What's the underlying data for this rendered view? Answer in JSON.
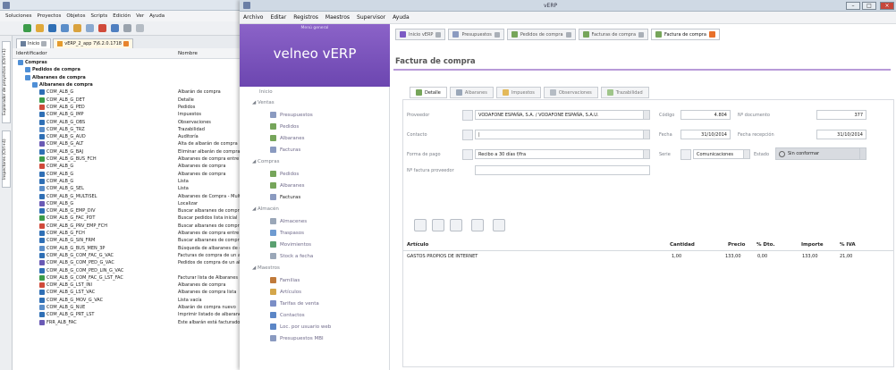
{
  "back_window": {
    "menu": [
      "Soluciones",
      "Proyectos",
      "Objetos",
      "Scripts",
      "Edición",
      "Ver",
      "Ayuda"
    ],
    "tabs": [
      {
        "label": "Inicio"
      },
      {
        "label": "vERP_2_app 7\\6.2.0.1718"
      }
    ],
    "side_tabs": [
      "Explorador de proyectos (Ctrl+1)",
      "Inspectores (Ctrl+4)"
    ],
    "columns": {
      "id": "Identificador",
      "name": "Nombre"
    },
    "tree": [
      {
        "id": "Compras",
        "desc": "",
        "level": 0,
        "bold": true
      },
      {
        "id": "Pedidos de compra",
        "desc": "",
        "level": 1,
        "bold": true
      },
      {
        "id": "Albaranes de compra",
        "desc": "",
        "level": 1,
        "bold": true
      },
      {
        "id": "Albaranes de compra",
        "desc": "",
        "level": 2,
        "bold": true
      },
      {
        "id": "COM_ALB_G",
        "desc": "Albarán de compra",
        "level": 3
      },
      {
        "id": "COM_ALB_G_DET",
        "desc": "Detalle",
        "level": 3
      },
      {
        "id": "COM_ALB_G_PED",
        "desc": "Pedidos",
        "level": 3
      },
      {
        "id": "COM_ALB_G_IMP",
        "desc": "Impuestos",
        "level": 3
      },
      {
        "id": "COM_ALB_G_OBS",
        "desc": "Observaciones",
        "level": 3
      },
      {
        "id": "COM_ALB_G_TRZ",
        "desc": "Trazabilidad",
        "level": 3
      },
      {
        "id": "COM_ALB_G_AUD",
        "desc": "Auditoría",
        "level": 3
      },
      {
        "id": "COM_ALB_G_ALT",
        "desc": "Alta de albarán de compra",
        "level": 3
      },
      {
        "id": "COM_ALB_G_BAJ",
        "desc": "Eliminar albarán de compra",
        "level": 3
      },
      {
        "id": "COM_ALB_G_BUS_FCH",
        "desc": "Albaranes de compra entre fechas",
        "level": 3
      },
      {
        "id": "COM_ALB_G",
        "desc": "Albaranes de compra",
        "level": 3
      },
      {
        "id": "COM_ALB_G",
        "desc": "Albaranes de compra",
        "level": 3
      },
      {
        "id": "COM_ALB_G",
        "desc": "Lista",
        "level": 3
      },
      {
        "id": "COM_ALB_G_SEL",
        "desc": "Lista",
        "level": 3
      },
      {
        "id": "COM_ALB_G_MULTISEL",
        "desc": "Albaranes de Compra - Multiselección",
        "level": 3
      },
      {
        "id": "COM_ALB_G",
        "desc": "Localizar",
        "level": 3
      },
      {
        "id": "COM_ALB_G_EMP_DIV",
        "desc": "Buscar albaranes de compra",
        "level": 3
      },
      {
        "id": "COM_ALB_G_FAC_PDT",
        "desc": "Buscar pedidos lista inicial",
        "level": 3
      },
      {
        "id": "COM_ALB_G_PRV_EMP_FCH",
        "desc": "Buscar albaranes de compra",
        "level": 3
      },
      {
        "id": "COM_ALB_G_FCH",
        "desc": "Albaranes de compra entre fechas",
        "level": 3
      },
      {
        "id": "COM_ALB_G_SIN_FRM",
        "desc": "Buscar albaranes de compra",
        "level": 3
      },
      {
        "id": "COM_ALB_G_BUS_MEN_3P",
        "desc": "Búsqueda de albaranes de compra",
        "level": 3
      },
      {
        "id": "COM_ALB_G_COM_FAC_G_VAC",
        "desc": "Facturas de compra de un albarán",
        "level": 3
      },
      {
        "id": "COM_ALB_G_COM_PED_G_VAC",
        "desc": "Pedidos de compra de un albarán",
        "level": 3
      },
      {
        "id": "COM_ALB_G_COM_PED_LIN_G_VAC",
        "desc": "",
        "level": 3
      },
      {
        "id": "COM_ALB_G_COM_FAC_G_LST_FAC",
        "desc": "Facturar lista de Albaranes",
        "level": 3
      },
      {
        "id": "COM_ALB_G_LST_INI",
        "desc": "Albaranes de compra",
        "level": 3
      },
      {
        "id": "COM_ALB_G_LST_VAC",
        "desc": "Albaranes de compra lista",
        "level": 3
      },
      {
        "id": "COM_ALB_G_MOV_G_VAC",
        "desc": "Lista vacía",
        "level": 3
      },
      {
        "id": "COM_ALB_G_NUE",
        "desc": "Albarán de compra nuevo",
        "level": 3
      },
      {
        "id": "COM_ALB_G_PRT_LST",
        "desc": "Imprimir listado de albaranes",
        "level": 3
      },
      {
        "id": "FRR_ALB_FAC",
        "desc": "Este albarán está facturado",
        "level": 3
      }
    ]
  },
  "front_window": {
    "title": "vERP",
    "menu": [
      "Archivo",
      "Editar",
      "Registros",
      "Maestros",
      "Supervisor",
      "Ayuda"
    ],
    "brand_sub": "Menú general",
    "brand": "velneo vERP",
    "nav": {
      "inicio": "Inicio",
      "ventas": "Ventas",
      "ventas_items": [
        "Presupuestos",
        "Pedidos",
        "Albaranes",
        "Facturas"
      ],
      "compras": "Compras",
      "compras_items": [
        "Pedidos",
        "Albaranes",
        "Facturas"
      ],
      "almacen": "Almacén",
      "almacen_items": [
        "Almacenes",
        "Traspasos",
        "Movimientos",
        "Stock a fecha"
      ],
      "maestros": "Maestros",
      "maestros_items": [
        "Familias",
        "Artículos",
        "Tarifas de venta",
        "Contactos",
        "Loc. por usuario web",
        "Presupuestos MBI"
      ]
    },
    "tabs": [
      "Inicio vERP",
      "Presupuestos",
      "Pedidos de compra",
      "Facturas de compra",
      "Factura de compra"
    ],
    "page_title": "Factura de compra",
    "inner_tabs": [
      "Detalle",
      "Albaranes",
      "Impuestos",
      "Observaciones",
      "Trazabilidad"
    ],
    "form": {
      "proveedor_label": "Proveedor",
      "proveedor": "VODAFONE ESPAÑA, S.A. / VODAFONE ESPAÑA, S.A.U.",
      "contacto_label": "Contacto",
      "contacto": "|",
      "forma_pago_label": "Forma de pago",
      "forma_pago": "Recibo a 30 días f/fra",
      "num_factura_label": "Nº factura proveedor",
      "num_factura": "",
      "codigo_label": "Código",
      "codigo": "4.804",
      "num_doc_label": "Nº documento",
      "num_doc": "377",
      "fecha_label": "Fecha",
      "fecha": "31/10/2014",
      "fecha_recep_label": "Fecha recepción",
      "fecha_recep": "31/10/2014",
      "serie_label": "Serie",
      "serie": "Comunicaciones",
      "estado_label": "Estado",
      "estado": "Sin conformar"
    },
    "grid": {
      "headers": [
        "Artículo",
        "Cantidad",
        "Precio",
        "% Dto.",
        "Importe",
        "% IVA"
      ],
      "rows": [
        [
          "GASTOS PROPIOS DE INTERNET",
          "1,00",
          "133,00",
          "0,00",
          "133,00",
          "21,00"
        ]
      ]
    }
  },
  "colors": {
    "brand": "#7a52bf",
    "accent_line": "#b89ad9"
  }
}
